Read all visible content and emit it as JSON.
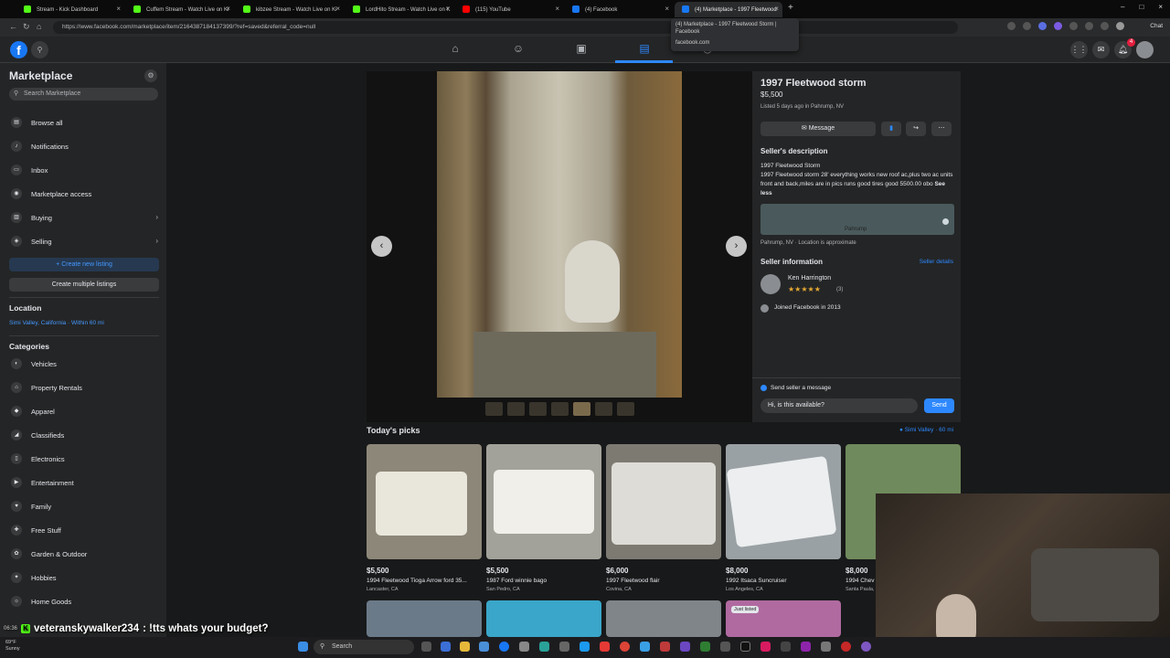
{
  "browser": {
    "tabs": [
      {
        "title": "Stream - Kick Dashboard",
        "color": "#53fc18"
      },
      {
        "title": "Cuffem Stream - Watch Live on Ki",
        "color": "#53fc18"
      },
      {
        "title": "kibzee Stream - Watch Live on Ki",
        "color": "#53fc18"
      },
      {
        "title": "LordHito Stream - Watch Live on K",
        "color": "#53fc18"
      },
      {
        "title": "(115) YouTube",
        "color": "#ff0000"
      },
      {
        "title": "(4) Facebook",
        "color": "#1877f2"
      },
      {
        "title": "(4) Marketplace - 1997 Fleetwood",
        "color": "#1877f2"
      }
    ],
    "url": "https://www.facebook.com/marketplace/item/2164387184137399/?ref=saved&referral_code=null",
    "tooltip_title": "(4) Marketplace - 1997 Fleetwood Storm | Facebook",
    "tooltip_domain": "facebook.com",
    "chat_label": "Chat"
  },
  "fbnav": {
    "logo": "f",
    "notifications_count": "4"
  },
  "sidebar": {
    "title": "Marketplace",
    "search_placeholder": "Search Marketplace",
    "items": [
      {
        "label": "Browse all",
        "icon": "store-icon"
      },
      {
        "label": "Notifications",
        "icon": "bell-icon"
      },
      {
        "label": "Inbox",
        "icon": "inbox-icon"
      },
      {
        "label": "Marketplace access",
        "icon": "access-icon"
      },
      {
        "label": "Buying",
        "icon": "bag-icon"
      },
      {
        "label": "Selling",
        "icon": "tag-icon"
      }
    ],
    "create_listing": "Create new listing",
    "create_multiple": "Create multiple listings",
    "location_heading": "Location",
    "location_value": "Simi Valley, California · Within 60 mi",
    "categories_heading": "Categories",
    "categories": [
      "Vehicles",
      "Property Rentals",
      "Apparel",
      "Classifieds",
      "Electronics",
      "Entertainment",
      "Family",
      "Free Stuff",
      "Garden & Outdoor",
      "Hobbies",
      "Home Goods"
    ]
  },
  "listing": {
    "title": "1997 Fleetwood storm",
    "price": "$5,500",
    "listed": "Listed 5 days ago in Pahrump, NV",
    "message_button": "Message",
    "seller_description_heading": "Seller's description",
    "description": "1997 Fleetwood Storm\n1997 Fleetwood storm 28' everything works new roof ac,plus two ac units front and back,miles are in pics runs good tires good  5500.00 obo",
    "see_less": "See less",
    "map_town": "Pahrump",
    "location": "Pahrump, NV · Location is approximate",
    "seller_info_heading": "Seller information",
    "seller_details": "Seller details",
    "seller_name": "Ken Harrington",
    "seller_rating_count": "(3)",
    "joined": "Joined Facebook in 2013",
    "send_label": "Send seller a message",
    "message_input": "Hi, is this available?",
    "send_button": "Send"
  },
  "picks": {
    "heading": "Today's picks",
    "location": "Simi Valley · 60 mi",
    "cards": [
      {
        "price": "$5,500",
        "name": "1994 Fleetwood Tioga Arrow ford 35...",
        "location": "Lancaster, CA",
        "color": "#8c8778"
      },
      {
        "price": "$5,500",
        "name": "1987 Ford winnie bago",
        "location": "San Pedro, CA",
        "color": "#a3a29a"
      },
      {
        "price": "$6,000",
        "name": "1997 Fleetwood flair",
        "location": "Covina, CA",
        "color": "#7d7a72"
      },
      {
        "price": "$8,000",
        "name": "1992 Itsaca Suncruiser",
        "location": "Los Angeles, CA",
        "color": "#9aa1a4"
      },
      {
        "price": "$8,000",
        "name": "1994 Chev",
        "location": "Santa Paula,",
        "color": "#6f8a5c"
      }
    ],
    "just_listed": "Just listed"
  },
  "overlay": {
    "chat_time": "06:36",
    "chat_user": "veteranskywalker234",
    "chat_message": ": !tts whats your budget?"
  },
  "taskbar": {
    "temperature": "69°F",
    "weather": "Sunny",
    "search": "Search"
  }
}
